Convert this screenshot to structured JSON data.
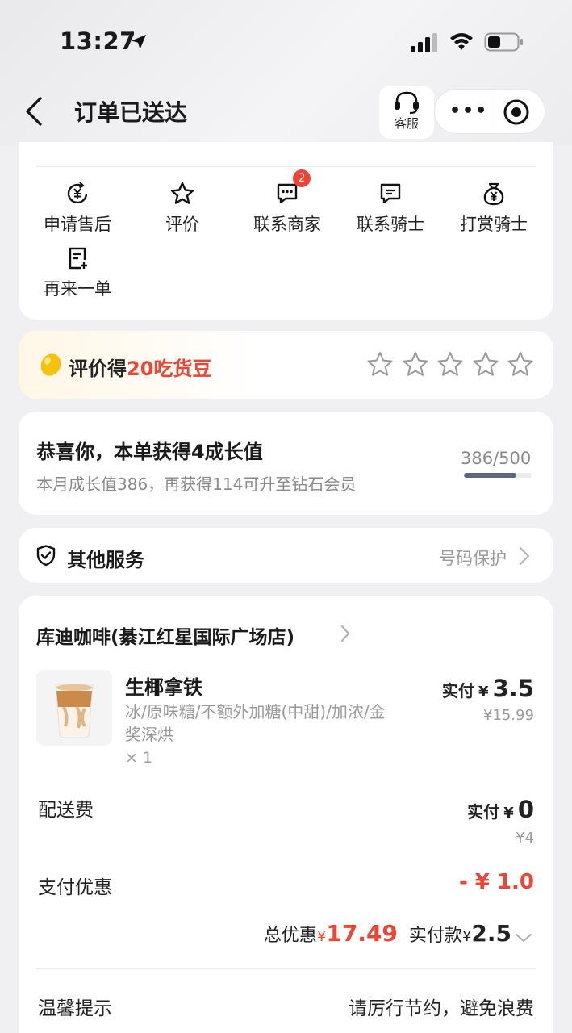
{
  "status_bar": {
    "time": "13:27"
  },
  "nav": {
    "title": "订单已送达",
    "customer_service": "客服",
    "more": "•••"
  },
  "actions": [
    {
      "label": "申请售后",
      "icon": "yen-refresh-icon"
    },
    {
      "label": "评价",
      "icon": "star-icon"
    },
    {
      "label": "联系商家",
      "icon": "chat-icon",
      "badge": "2"
    },
    {
      "label": "联系骑士",
      "icon": "chat-icon"
    },
    {
      "label": "打赏骑士",
      "icon": "money-bag-icon"
    },
    {
      "label": "再来一单",
      "icon": "reorder-icon"
    }
  ],
  "review": {
    "prefix": "评价得",
    "highlight": "20吃货豆",
    "star_count": 5,
    "rating": 0
  },
  "growth": {
    "title": "恭喜你，本单获得4成长值",
    "subtitle": "本月成长值386，再获得114可升至钻石会员",
    "count": "386/500",
    "progress": 0.772
  },
  "services": {
    "title": "其他服务",
    "right_text": "号码保护"
  },
  "order": {
    "store_name": "库迪咖啡(綦江红星国际广场店)",
    "product": {
      "name": "生椰拿铁",
      "spec": "冰/原味糖/不额外加糖(中甜)/加浓/金奖深烘",
      "qty": "× 1",
      "paid_label": "实付",
      "yen": "¥",
      "paid_amount": "3.5",
      "original_price": "¥15.99"
    },
    "delivery": {
      "label": "配送费",
      "paid_label": "实付",
      "yen": "¥",
      "paid_amount": "0",
      "original_price": "¥4"
    },
    "discount": {
      "label": "支付优惠",
      "amount": "- ¥ 1.0"
    },
    "totals": {
      "discount_label": "总优惠",
      "yen": "¥",
      "discount_amount": "17.49",
      "paid_label": "实付款",
      "paid_amount": "2.5"
    },
    "tip": {
      "label": "温馨提示",
      "text": "请厉行节约，避免浪费"
    }
  },
  "colors": {
    "accent_red": "#ee4433",
    "background": "#f0f0f2",
    "progress": "#5d6680"
  }
}
